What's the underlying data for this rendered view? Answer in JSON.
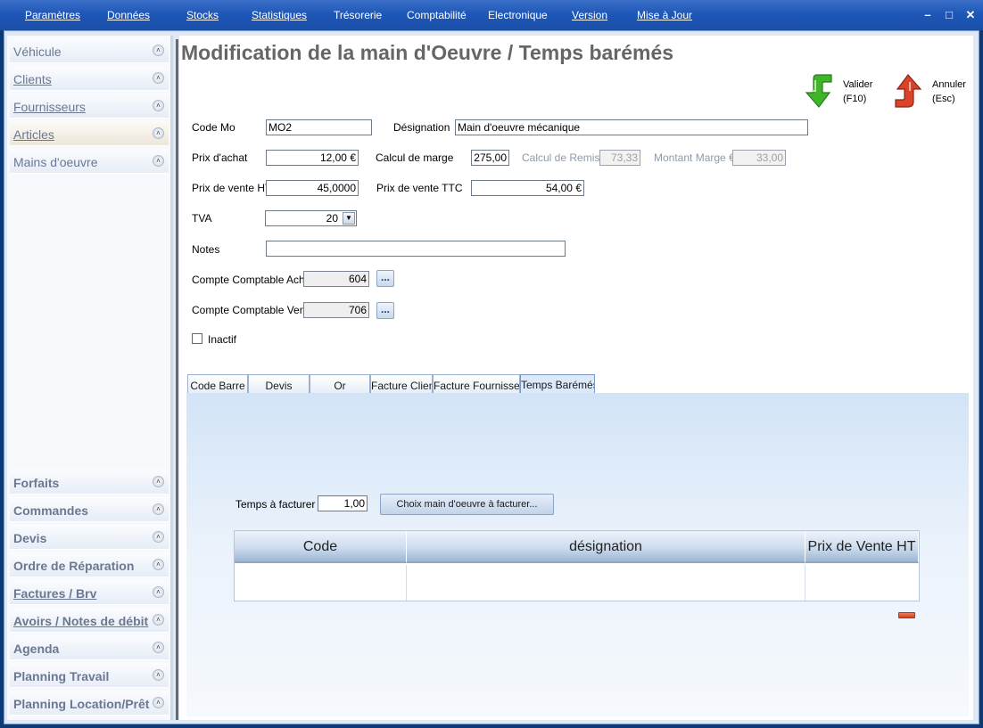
{
  "menubar": {
    "items": [
      "Paramètres",
      "Données",
      "Stocks",
      "Statistiques",
      "Trésorerie",
      "Comptabilité",
      "Electronique",
      "Version",
      "Mise à Jour"
    ],
    "minimize": "–",
    "maximize": "□",
    "close": "✕"
  },
  "sidebar": {
    "top_items": [
      {
        "label": "Véhicule",
        "icon": "chevron-up-icon"
      },
      {
        "label": "Clients",
        "icon": "chevron-up-icon"
      },
      {
        "label": "Fournisseurs",
        "icon": "chevron-up-icon"
      },
      {
        "label": "Articles",
        "icon": "chevron-up-icon"
      },
      {
        "label": "Mains d'oeuvre",
        "icon": "chevron-up-icon"
      }
    ],
    "bottom_items": [
      {
        "label": "Forfaits"
      },
      {
        "label": "Commandes"
      },
      {
        "label": "Devis"
      },
      {
        "label": "Ordre de Réparation"
      },
      {
        "label": "Factures / Brv"
      },
      {
        "label": "Avoirs / Notes de débit"
      },
      {
        "label": "Agenda"
      },
      {
        "label": "Planning Travail"
      },
      {
        "label": "Planning Location/Prêt"
      }
    ],
    "chevron": "˄"
  },
  "page": {
    "title": "Modification de la main d'Oeuvre / Temps barémés"
  },
  "actions": {
    "validate_label": "Valider",
    "validate_key": "(F10)",
    "cancel_label": "Annuler",
    "cancel_key": "(Esc)",
    "validate_color": "#3fb52a",
    "cancel_color": "#d8432a"
  },
  "form": {
    "code_mo_label": "Code Mo",
    "code_mo_value": "MO2",
    "designation_label": "Désignation",
    "designation_value": "Main d'oeuvre mécanique",
    "prix_achat_label": "Prix d'achat",
    "prix_achat_value": "12,00 €",
    "calcul_marge_label": "Calcul de marge",
    "calcul_marge_value": "275,00",
    "calcul_remise_label": "Calcul de Remise",
    "calcul_remise_value": "73,33",
    "montant_marge_label": "Montant Marge €",
    "montant_marge_value": "33,00",
    "prix_vente_ht_label": "Prix de vente HT",
    "prix_vente_ht_value": "45,0000",
    "prix_vente_ttc_label": "Prix de vente TTC",
    "prix_vente_ttc_value": "54,00 €",
    "tva_label": "TVA",
    "tva_value": "20",
    "notes_label": "Notes",
    "notes_value": "",
    "compte_achat_label": "Compte Comptable Achat",
    "compte_achat_value": "604",
    "compte_vente_label": "Compte Comptable Vente",
    "compte_vente_value": "706",
    "browse_label": "...",
    "inactif_label": "Inactif",
    "inactif_checked": false
  },
  "tabs": [
    {
      "label": "Code Barre"
    },
    {
      "label": "Devis"
    },
    {
      "label": "Or"
    },
    {
      "label": "Facture Client"
    },
    {
      "label": "Facture Fournisseur"
    },
    {
      "label": "Temps Barémés",
      "active": true
    }
  ],
  "temps_panel": {
    "temps_label": "Temps à facturer",
    "temps_value": "1,00",
    "choose_button": "Choix main d'oeuvre à facturer...",
    "grid_headers": [
      "Code",
      "désignation",
      "Prix de Vente HT"
    ],
    "grid_rows": []
  }
}
